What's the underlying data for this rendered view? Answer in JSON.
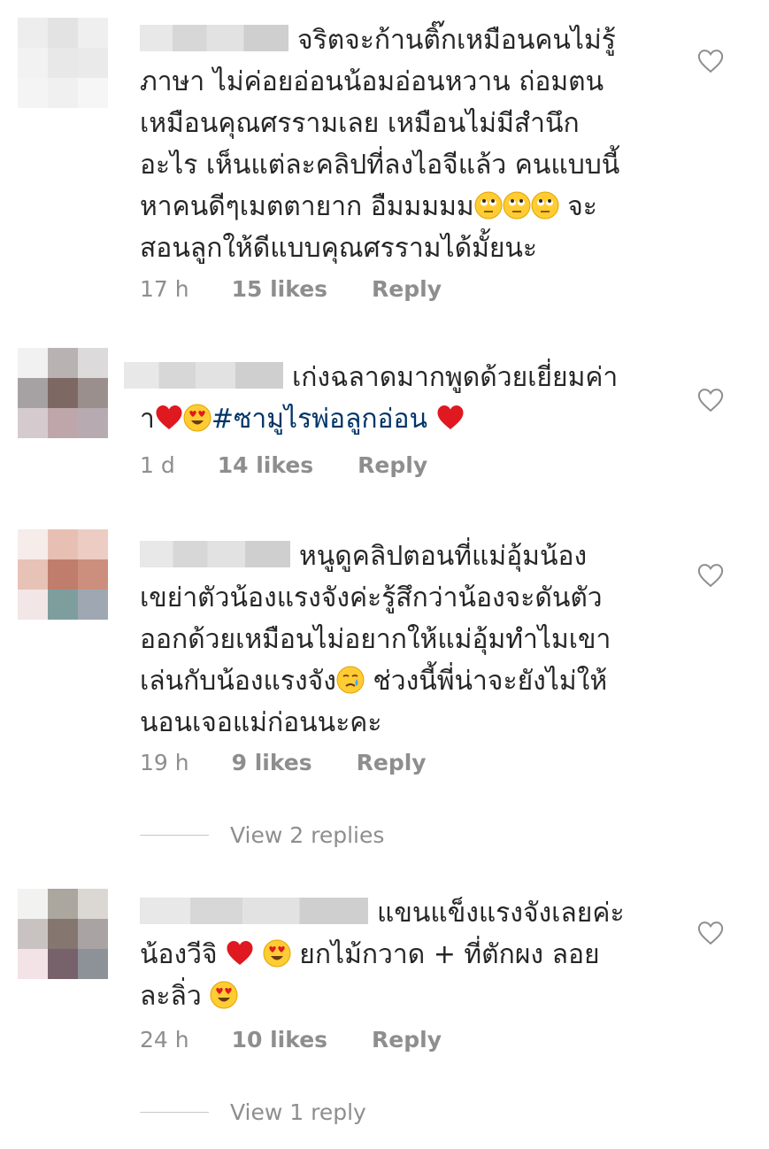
{
  "comments": [
    {
      "text_before": "จริตจะก้านติ๊กเหมือนคนไม่รู้\nภาษา ไม่ค่อยอ่อนน้อมอ่อนหวาน ถ่อมตน\nเหมือนคุณศรรามเลย เหมือนไม่มีสำนึก\nอะไร เห็นแต่ละคลิปที่ลงไอจีแล้ว คนแบบนี้\nหาคนดีๆเมตตายาก อืมมมมม",
      "emojis": [
        "eye-roll-emoji",
        "eye-roll-emoji",
        "eye-roll-emoji"
      ],
      "text_after": " จะ\nสอนลูกให้ดีแบบคุณศรรามได้มั้ยนะ",
      "time": "17 h",
      "likes": "15 likes",
      "reply": "Reply"
    },
    {
      "text_before": "เก่งฉลาดมากพูดด้วยเยี่ยมค่า\nา",
      "hashtag": "#ซามูไรพ่อลูกอ่อน",
      "time": "1 d",
      "likes": "14 likes",
      "reply": "Reply"
    },
    {
      "text_before": "หนูดูคลิปตอนที่แม่อุ้มน้อง\nเขย่าตัวน้องแรงจังค่ะรู้สึกว่าน้องจะดันตัว\nออกด้วยเหมือนไม่อยากให้แม่อุ้มทำไมเขา\nเล่นกับน้องแรงจัง",
      "text_after": " ช่วงนี้พี่น่าจะยังไม่ให้\nนอนเจอแม่ก่อนนะคะ",
      "time": "19 h",
      "likes": "9 likes",
      "reply": "Reply",
      "view_replies": "View 2 replies"
    },
    {
      "text_before": "แขนแข็งแรงจังเลยค่ะ\nน้องวีจิ",
      "text_mid": " ยกไม้กวาด + ที่ตักผง ลอย\nละลิ่ว ",
      "time": "24 h",
      "likes": "10 likes",
      "reply": "Reply",
      "view_replies": "View 1 reply"
    }
  ],
  "colors": {
    "text": "#262626",
    "meta": "#8e8e8e",
    "hashtag": "#003569",
    "heart_red": "#e0181f",
    "emoji_yellow": "#ffcc33"
  }
}
